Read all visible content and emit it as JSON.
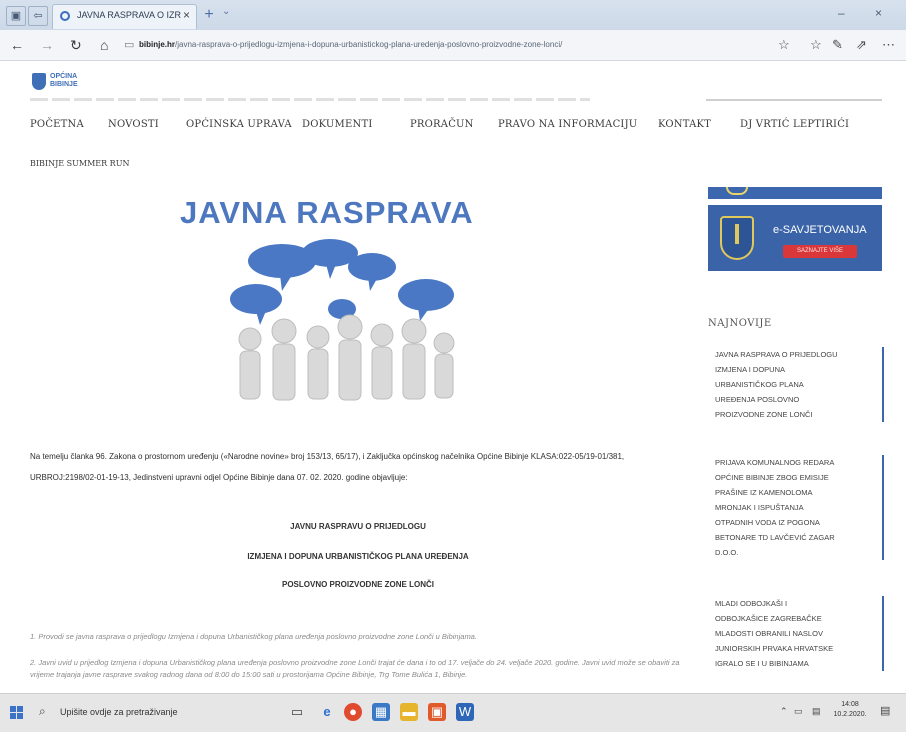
{
  "browser": {
    "tab_title": "JAVNA RASPRAVA O IZR",
    "tab_close": "×",
    "new_tab": "+",
    "tab_menu": "⌄",
    "back": "←",
    "forward": "→",
    "refresh": "↻",
    "home": "⌂",
    "url_domain": "bibinje.hr",
    "url_path": "/javna-rasprava-o-prijedlogu-izmjena-i-dopuna-urbanistickog-plana-uredenja-poslovno-proizvodne-zone-lonci/",
    "minimize": "–",
    "close": "×"
  },
  "site": {
    "logo_text_1": "OPĆINA",
    "logo_text_2": "BIBINJE",
    "menu": [
      "POČETNA",
      "NOVOSTI",
      "OPĆINSKA UPRAVA",
      "DOKUMENTI",
      "PRORAČUN",
      "PRAVO NA INFORMACIJU",
      "KONTAKT",
      "DJ VRTIĆ LEPTIRIĆI"
    ],
    "breadcrumb": "BIBINJE SUMMER RUN"
  },
  "article": {
    "headline": "JAVNA RASPRAVA",
    "paragraph": "Na temelju članka 96. Zakona o prostornom uređenju («Narodne novine» broj 153/13, 65/17), i Zaključka općinskog načelnika Općine Bibinje KLASA:022-05/19-01/381, URBROJ:2198/02-01-19-13, Jedinstveni upravni odjel Općine Bibinje dana 07. 02. 2020. godine objavljuje:",
    "decl_1": "JAVNU RASPRAVU O PRIJEDLOGU",
    "decl_2": "IZMJENA I DOPUNA URBANISTIČKOG PLANA UREĐENJA",
    "decl_3": "POSLOVNO PROIZVODNE ZONE LONČI",
    "list_1": "1.  Provodi se javna rasprava o prijedlogu Izmjena i dopuna Urbanističkog plana uređenja poslovno proizvodne zone Lonči u Bibinjama.",
    "list_2": "2.  Javni uvid u prijedlog Izmjena i dopuna Urbanističkog plana uređenja poslovno proizvodne zone Lonči trajat će dana i to od 17. veljače do 24. veljače 2020. godine. Javni uvid može se obaviti za vrijeme trajanja javne rasprave svakog radnog dana od 8:00 do 15:00 sati u prostorijama Općine Bibinje, Trg Tome Bulića 1, Bibinje."
  },
  "sidebar": {
    "esav_title": "e-SAVJETOVANJA",
    "esav_button": "SAZNAJTE VIŠE",
    "latest_title": "NAJNOVIJE",
    "items": [
      [
        "JAVNA RASPRAVA O PRIJEDLOGU",
        "IZMJENA I DOPUNA",
        "URBANISTIČKOG PLANA",
        "UREĐENJA POSLOVNO",
        "PROIZVODNE ZONE LONČI"
      ],
      [
        "PRIJAVA KOMUNALNOG REDARA",
        "OPĆINE BIBINJE ZBOG EMISIJE",
        "PRAŠINE IZ KAMENOLOMA",
        "MRONJAK I ISPUŠTANJA",
        "OTPADNIH VODA IZ POGONA",
        "BETONARE TD LAVČEVIĆ ZAGAR",
        "D.O.O."
      ],
      [
        "MLADI ODBOJKAŠI I",
        "ODBOJKAŠICE ZAGREBAČKE",
        "MLADOSTI OBRANILI NASLOV",
        "JUNIORSKIH PRVAKA HRVATSKE",
        "IGRALO SE I U BIBINJAMA"
      ]
    ]
  },
  "taskbar": {
    "search_placeholder": "Upišite ovdje za pretraživanje",
    "clock_time": "14:08",
    "clock_date": "10.2.2020."
  },
  "colors": {
    "brand_blue": "#3c66ad",
    "headline_blue": "#4d78bf",
    "esav_red": "#d9373a"
  }
}
